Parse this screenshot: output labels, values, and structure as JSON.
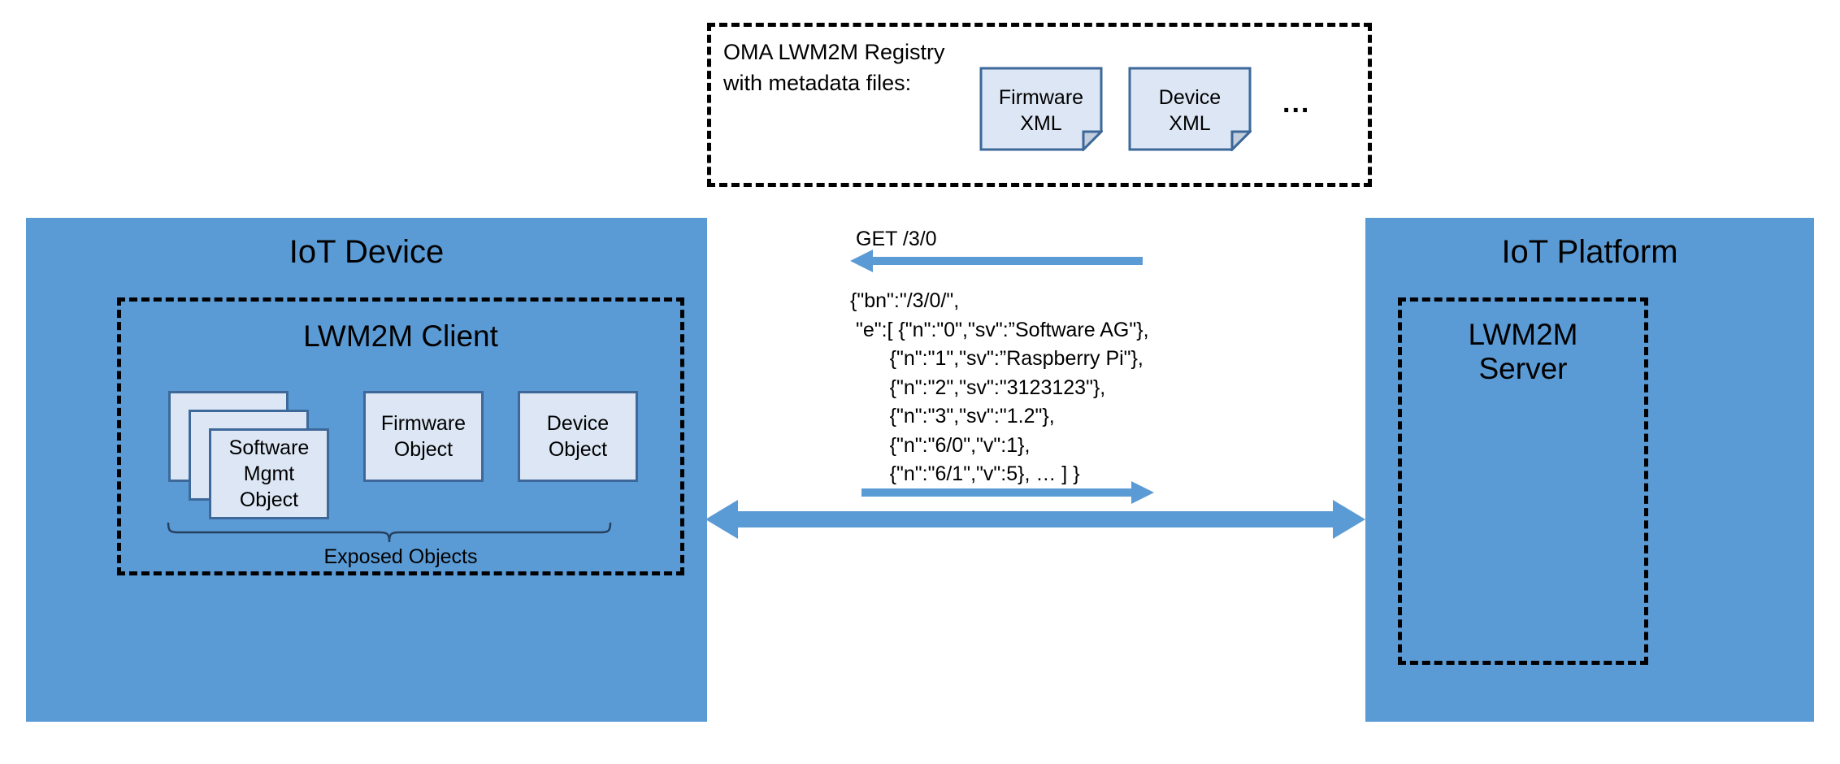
{
  "registry": {
    "label": "OMA LWM2M Registry\nwith metadata files:",
    "documents": [
      {
        "name": "Firmware XML",
        "line1": "Firmware",
        "line2": "XML"
      },
      {
        "name": "Device XML",
        "line1": "Device",
        "line2": "XML"
      }
    ],
    "ellipsis": "..."
  },
  "device_panel": {
    "title": "IoT Device",
    "client": {
      "title": "LWM2M Client",
      "objects": [
        {
          "line1": "Software",
          "line2": "Mgmt",
          "line3": "Object",
          "stacked": true
        },
        {
          "line1": "Firmware",
          "line2": "Object",
          "stacked": false
        },
        {
          "line1": "Device",
          "line2": "Object",
          "stacked": false
        }
      ],
      "brace_caption": "Exposed Objects"
    }
  },
  "platform_panel": {
    "title": "IoT Platform",
    "server": {
      "line1": "LWM2M",
      "line2": "Server"
    }
  },
  "flow": {
    "request_label": "GET /3/0",
    "response_payload": "{\"bn\":\"/3/0/\",\n \"e\":[ {\"n\":\"0\",\"sv\":”Software AG\"},\n       {\"n\":\"1\",\"sv\":”Raspberry Pi\"},\n       {\"n\":\"2\",\"sv\":\"3123123\"},\n       {\"n\":\"3\",\"sv\":\"1.2\"},\n       {\"n\":\"6/0\",\"v\":1},\n       {\"n\":\"6/1\",\"v\":5}, … ] }"
  },
  "colors": {
    "panel_blue": "#5B9BD5",
    "object_fill": "#DCE6F4",
    "object_border": "#3D6899",
    "arrow_blue": "#5B9BD5",
    "dash_black": "#000000",
    "background": "#FFFFFF"
  }
}
